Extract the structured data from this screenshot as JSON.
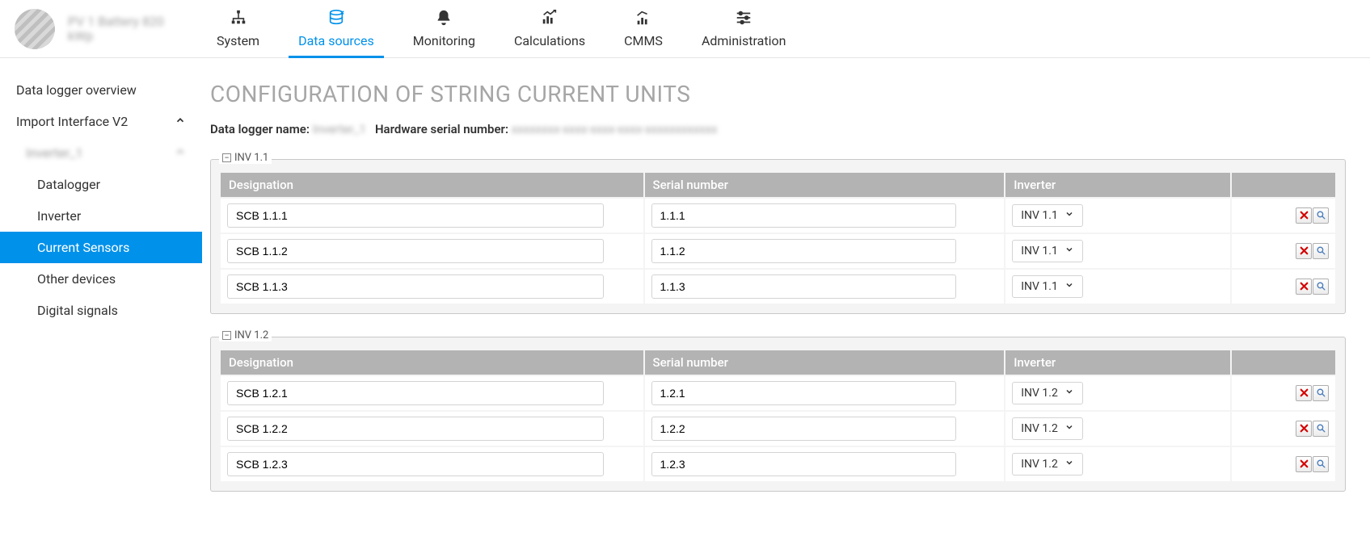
{
  "header": {
    "project_name": "PV 1 Battery 820 kWp",
    "tabs": [
      {
        "id": "system",
        "label": "System"
      },
      {
        "id": "data-sources",
        "label": "Data sources"
      },
      {
        "id": "monitoring",
        "label": "Monitoring"
      },
      {
        "id": "calculations",
        "label": "Calculations"
      },
      {
        "id": "cmms",
        "label": "CMMS"
      },
      {
        "id": "administration",
        "label": "Administration"
      }
    ],
    "active_tab": "data-sources"
  },
  "sidebar": {
    "items": {
      "overview_label": "Data logger overview",
      "import_interface_label": "Import Interface V2",
      "child_group_label": "Inverter_1",
      "datalogger_label": "Datalogger",
      "inverter_label": "Inverter",
      "current_sensors_label": "Current Sensors",
      "other_devices_label": "Other devices",
      "digital_signals_label": "Digital signals"
    }
  },
  "main": {
    "title": "CONFIGURATION OF STRING CURRENT UNITS",
    "meta": {
      "logger_label": "Data logger name:",
      "logger_value": "Inverter_1",
      "hw_label": "Hardware serial number:",
      "hw_value": "xxxxxxxx-xxxx-xxxx-xxxx-xxxxxxxxxxxx"
    },
    "columns": {
      "designation": "Designation",
      "serial": "Serial number",
      "inverter": "Inverter"
    },
    "groups": [
      {
        "name": "INV 1.1",
        "rows": [
          {
            "designation": "SCB 1.1.1",
            "serial": "1.1.1",
            "inverter": "INV 1.1"
          },
          {
            "designation": "SCB 1.1.2",
            "serial": "1.1.2",
            "inverter": "INV 1.1"
          },
          {
            "designation": "SCB 1.1.3",
            "serial": "1.1.3",
            "inverter": "INV 1.1"
          }
        ]
      },
      {
        "name": "INV 1.2",
        "rows": [
          {
            "designation": "SCB 1.2.1",
            "serial": "1.2.1",
            "inverter": "INV 1.2"
          },
          {
            "designation": "SCB 1.2.2",
            "serial": "1.2.2",
            "inverter": "INV 1.2"
          },
          {
            "designation": "SCB 1.2.3",
            "serial": "1.2.3",
            "inverter": "INV 1.2"
          }
        ]
      }
    ]
  }
}
